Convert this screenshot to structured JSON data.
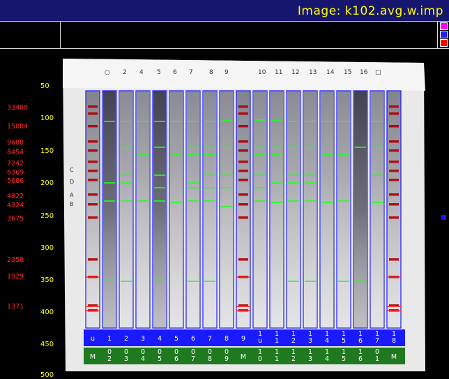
{
  "window": {
    "title": "Image:  k102.avg.w.imp"
  },
  "scale_ticks": [
    "50",
    "100",
    "150",
    "200",
    "250",
    "300",
    "350",
    "400",
    "450",
    "500"
  ],
  "mw_labels": [
    "33408",
    "15004",
    "9688",
    "8454",
    "7242",
    "6369",
    "5686",
    "4822",
    "4324",
    "3675",
    "2358",
    "1929",
    "1371"
  ],
  "handwritten_labels": [
    "C",
    "D",
    "A",
    "B"
  ],
  "lane_top_labels": [
    "u",
    "1",
    "2",
    "3",
    "4",
    "5",
    "6",
    "7",
    "8",
    "9",
    "1\nu",
    "1\n1",
    "1\n2",
    "1\n3",
    "1\n4",
    "1\n5",
    "1\n6",
    "1\n7",
    "1\n8"
  ],
  "lane_bottom_labels": [
    "M",
    "0\n2",
    "0\n3",
    "0\n4",
    "0\n5",
    "0\n6",
    "0\n7",
    "0\n8",
    "0\n9",
    "M",
    "1\n0",
    "1\n1",
    "1\n2",
    "1\n3",
    "1\n4",
    "1\n5",
    "1\n6",
    "0\n1",
    "M"
  ],
  "colors": {
    "title_bar": "#16166e",
    "title_text": "#ffff00",
    "lane_outline": "#1a1aff",
    "band_green": "#22ff22",
    "band_red": "#ff2020",
    "label_blue": "#1a1aff",
    "label_green": "#1f7a1f",
    "mw_red": "#ff3030"
  },
  "control_buttons": [
    {
      "name": "magenta-button",
      "color": "#ff00ff"
    },
    {
      "name": "blue-button",
      "color": "#2020ff"
    },
    {
      "name": "red-button",
      "color": "#ff0000"
    }
  ]
}
